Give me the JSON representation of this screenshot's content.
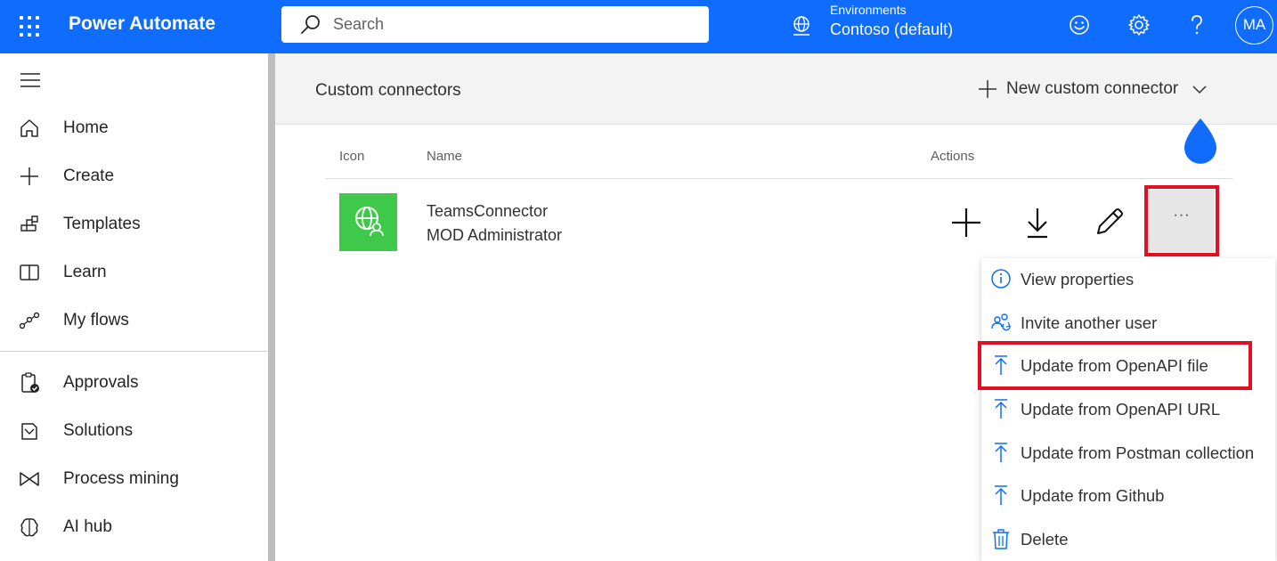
{
  "topbar": {
    "app_title": "Power Automate",
    "search_placeholder": "Search",
    "environment_label": "Environments",
    "environment_name": "Contoso (default)",
    "avatar_initials": "MA",
    "brand_color": "#0f6cfc"
  },
  "sidebar": {
    "items": [
      {
        "label": "Home",
        "icon": "home-icon"
      },
      {
        "label": "Create",
        "icon": "plus-icon"
      },
      {
        "label": "Templates",
        "icon": "templates-icon"
      },
      {
        "label": "Learn",
        "icon": "book-icon"
      },
      {
        "label": "My flows",
        "icon": "flows-icon"
      },
      {
        "label": "Approvals",
        "icon": "clipboard-check-icon"
      },
      {
        "label": "Solutions",
        "icon": "solutions-icon"
      },
      {
        "label": "Process mining",
        "icon": "process-mining-icon"
      },
      {
        "label": "AI hub",
        "icon": "brain-icon"
      }
    ]
  },
  "main": {
    "page_title": "Custom connectors",
    "new_button_label": "New custom connector",
    "columns": {
      "icon": "Icon",
      "name": "Name",
      "actions": "Actions"
    },
    "connector": {
      "name": "TeamsConnector",
      "owner": "MOD Administrator",
      "icon_color": "#3ec94a"
    },
    "more_label": "···"
  },
  "menu": {
    "items": [
      {
        "label": "View properties",
        "icon": "info-icon"
      },
      {
        "label": "Invite another user",
        "icon": "invite-user-icon"
      },
      {
        "label": "Update from OpenAPI file",
        "icon": "upload-icon"
      },
      {
        "label": "Update from OpenAPI URL",
        "icon": "upload-icon"
      },
      {
        "label": "Update from Postman collection",
        "icon": "upload-icon"
      },
      {
        "label": "Update from Github",
        "icon": "upload-icon"
      },
      {
        "label": "Delete",
        "icon": "trash-icon"
      }
    ],
    "highlight_color": "#e5101f"
  }
}
